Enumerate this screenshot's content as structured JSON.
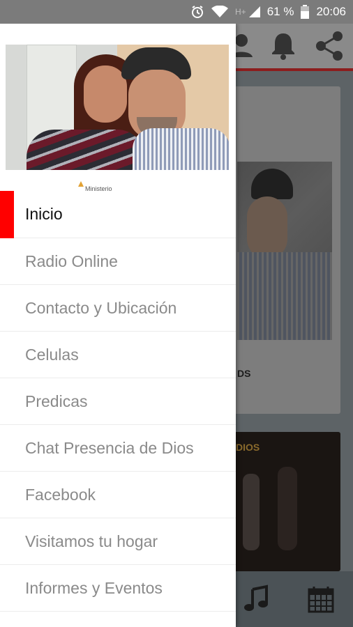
{
  "status_bar": {
    "network": "H+",
    "battery": "61 %",
    "time": "20:06"
  },
  "app_behind": {
    "card_text": "DS",
    "card2_text": "DIOS"
  },
  "drawer": {
    "logo_text": "Ministerio",
    "menu_items": [
      {
        "label": "Inicio",
        "active": true
      },
      {
        "label": "Radio Online",
        "active": false
      },
      {
        "label": "Contacto y Ubicación",
        "active": false
      },
      {
        "label": "Celulas",
        "active": false
      },
      {
        "label": "Predicas",
        "active": false
      },
      {
        "label": "Chat Presencia de Dios",
        "active": false
      },
      {
        "label": "Facebook",
        "active": false
      },
      {
        "label": "Visitamos tu hogar",
        "active": false
      },
      {
        "label": "Informes y Eventos",
        "active": false
      }
    ]
  },
  "colors": {
    "active_marker": "#ff0000",
    "menu_text": "#8a8a8a",
    "active_text": "#111111"
  }
}
